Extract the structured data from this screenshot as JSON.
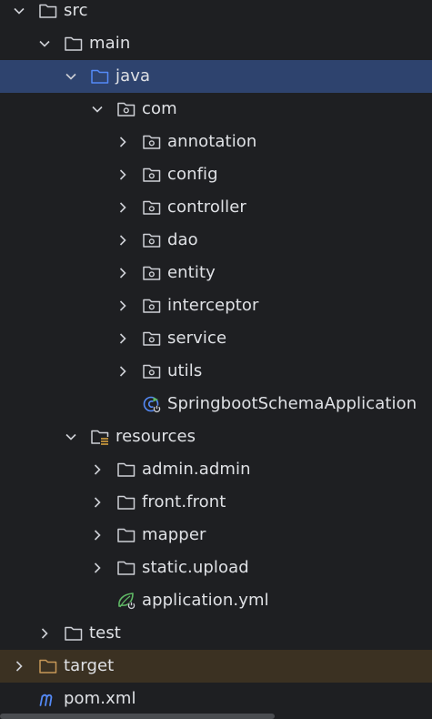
{
  "tree": {
    "src": {
      "label": "src",
      "state": "expanded"
    },
    "main": {
      "label": "main",
      "state": "expanded"
    },
    "java": {
      "label": "java",
      "state": "expanded",
      "selected": true
    },
    "com": {
      "label": "com",
      "state": "expanded"
    },
    "annotation": {
      "label": "annotation",
      "state": "collapsed"
    },
    "config": {
      "label": "config",
      "state": "collapsed"
    },
    "controller": {
      "label": "controller",
      "state": "collapsed"
    },
    "dao": {
      "label": "dao",
      "state": "collapsed"
    },
    "entity": {
      "label": "entity",
      "state": "collapsed"
    },
    "interceptor": {
      "label": "interceptor",
      "state": "collapsed"
    },
    "service": {
      "label": "service",
      "state": "collapsed"
    },
    "utils": {
      "label": "utils",
      "state": "collapsed"
    },
    "app_class": {
      "label": "SpringbootSchemaApplication"
    },
    "resources": {
      "label": "resources",
      "state": "expanded"
    },
    "admin": {
      "label": "admin.admin",
      "state": "collapsed"
    },
    "front": {
      "label": "front.front",
      "state": "collapsed"
    },
    "mapper": {
      "label": "mapper",
      "state": "collapsed"
    },
    "static_upload": {
      "label": "static.upload",
      "state": "collapsed"
    },
    "app_yml": {
      "label": "application.yml"
    },
    "test": {
      "label": "test",
      "state": "collapsed"
    },
    "target": {
      "label": "target",
      "state": "collapsed",
      "excluded": true
    },
    "pom": {
      "label": "pom.xml"
    }
  },
  "colors": {
    "background": "#1e1f22",
    "selected_row": "#2e436e",
    "excluded_row": "#3b3122",
    "text": "#dfe1e5",
    "folder_stroke": "#ced0d6",
    "source_folder": "#548af7",
    "excluded_folder": "#c69757",
    "resource_accent": "#e0a93f",
    "spring_green": "#5fb865",
    "maven_blue": "#548af7"
  }
}
